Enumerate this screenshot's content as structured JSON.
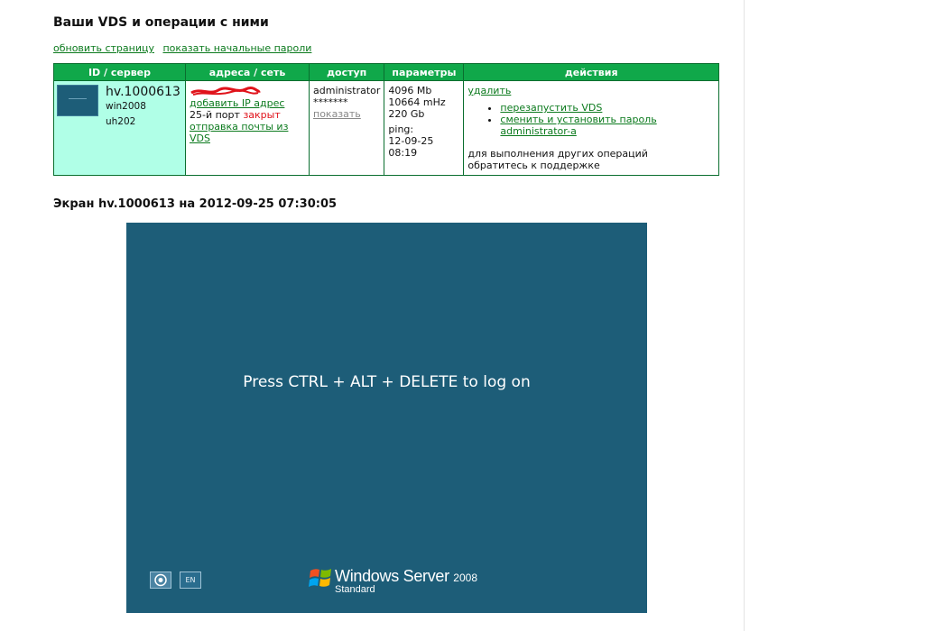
{
  "page": {
    "title": "Ваши VDS и операции с ними"
  },
  "links": {
    "refresh": "обновить страницу",
    "show_passwords": "показать начальные пароли"
  },
  "table": {
    "headers": [
      "ID / сервер",
      "адреса / сеть",
      "доступ",
      "параметры",
      "действия"
    ],
    "server": {
      "name": "hv.1000613",
      "os": "win2008",
      "host": "uh202"
    },
    "address": {
      "add_ip": "добавить IP адрес",
      "port_prefix": "25-й порт",
      "port_state": "закрыт",
      "mail": "отправка почты из VDS"
    },
    "access": {
      "user": "administrator",
      "password_mask": "*******",
      "show": "показать"
    },
    "params": {
      "ram": "4096 Mb",
      "cpu": "10664 mHz",
      "disk": "220 Gb",
      "ping_label": "ping:",
      "ping_time": "12-09-25 08:19"
    },
    "actions": {
      "delete": "удалить",
      "restart": "перезапустить VDS",
      "change_password": "сменить и установить пароль administrator-а",
      "note_line1": "для выполнения других операций",
      "note_line2": "обратитесь к поддержке"
    }
  },
  "screen": {
    "title": "Экран hv.1000613 на 2012-09-25 07:30:05",
    "message": "Press CTRL + ALT + DELETE to log on",
    "lang": "EN",
    "product_name": "Windows Server",
    "product_version": "2008",
    "edition": "Standard"
  },
  "colors": {
    "header_green": "#10a84a",
    "link_green": "#0b7a1d",
    "id_cell": "#b0ffe7",
    "screen_bg": "#1d5d78",
    "red": "#e0131b"
  }
}
